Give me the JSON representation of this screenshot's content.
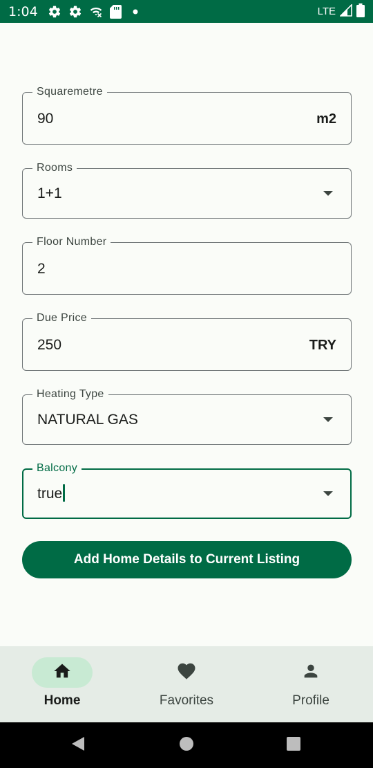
{
  "status_bar": {
    "time": "1:04",
    "network": "LTE",
    "icons": [
      "settings-icon",
      "settings-icon",
      "wifi-off-icon",
      "sd-card-icon",
      "notification-dot-icon",
      "signal-icon",
      "battery-icon"
    ]
  },
  "form": {
    "squaremetre": {
      "label": "Squaremetre",
      "value": "90",
      "suffix": "m2"
    },
    "rooms": {
      "label": "Rooms",
      "value": "1+1"
    },
    "floor_number": {
      "label": "Floor Number",
      "value": "2"
    },
    "due_price": {
      "label": "Due Price",
      "value": "250",
      "suffix": "TRY"
    },
    "heating_type": {
      "label": "Heating Type",
      "value": "NATURAL GAS"
    },
    "balcony": {
      "label": "Balcony",
      "value": "true"
    }
  },
  "submit_button": {
    "label": "Add Home Details to Current Listing"
  },
  "bottom_nav": {
    "items": [
      {
        "label": "Home",
        "icon": "home-icon",
        "active": true
      },
      {
        "label": "Favorites",
        "icon": "heart-icon",
        "active": false
      },
      {
        "label": "Profile",
        "icon": "person-icon",
        "active": false
      }
    ]
  },
  "colors": {
    "primary": "#006b45",
    "background": "#fafcf8",
    "nav_background": "#e5ece6",
    "nav_active_pill": "#c8ead3"
  }
}
